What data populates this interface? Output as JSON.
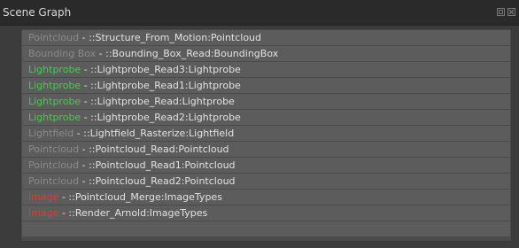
{
  "window": {
    "title": "Scene Graph"
  },
  "colors": {
    "grey": "#8a8a8a",
    "green": "#3fd14a",
    "red": "#e23b2b",
    "text": "#e2e2e2"
  },
  "rows": [
    {
      "type": "Pointcloud",
      "type_color": "#8a8a8a",
      "sep": " - ",
      "path": "::Structure_From_Motion:Pointcloud"
    },
    {
      "type": "Bounding Box",
      "type_color": "#8a8a8a",
      "sep": " - ",
      "path": "::Bounding_Box_Read:BoundingBox"
    },
    {
      "type": "Lightprobe",
      "type_color": "#3fd14a",
      "sep": " - ",
      "path": "::Lightprobe_Read3:Lightprobe"
    },
    {
      "type": "Lightprobe",
      "type_color": "#3fd14a",
      "sep": " - ",
      "path": "::Lightprobe_Read1:Lightprobe"
    },
    {
      "type": "Lightprobe",
      "type_color": "#3fd14a",
      "sep": " - ",
      "path": "::Lightprobe_Read:Lightprobe"
    },
    {
      "type": "Lightprobe",
      "type_color": "#3fd14a",
      "sep": " - ",
      "path": "::Lightprobe_Read2:Lightprobe"
    },
    {
      "type": "Lightfield",
      "type_color": "#8a8a8a",
      "sep": " - ",
      "path": "::Lightfield_Rasterize:Lightfield"
    },
    {
      "type": "Pointcloud",
      "type_color": "#8a8a8a",
      "sep": " - ",
      "path": "::Pointcloud_Read:Pointcloud"
    },
    {
      "type": "Pointcloud",
      "type_color": "#8a8a8a",
      "sep": " - ",
      "path": "::Pointcloud_Read1:Pointcloud"
    },
    {
      "type": "Pointcloud",
      "type_color": "#8a8a8a",
      "sep": " - ",
      "path": "::Pointcloud_Read2:Pointcloud"
    },
    {
      "type": "Image",
      "type_color": "#e23b2b",
      "sep": " - ",
      "path": "::Pointcloud_Merge:ImageTypes"
    },
    {
      "type": "Image",
      "type_color": "#e23b2b",
      "sep": " - ",
      "path": "::Render_Arnold:ImageTypes"
    },
    {
      "type": "",
      "type_color": "#8a8a8a",
      "sep": "",
      "path": ""
    }
  ],
  "icons": {
    "float": "float-window-icon",
    "close": "close-icon"
  }
}
